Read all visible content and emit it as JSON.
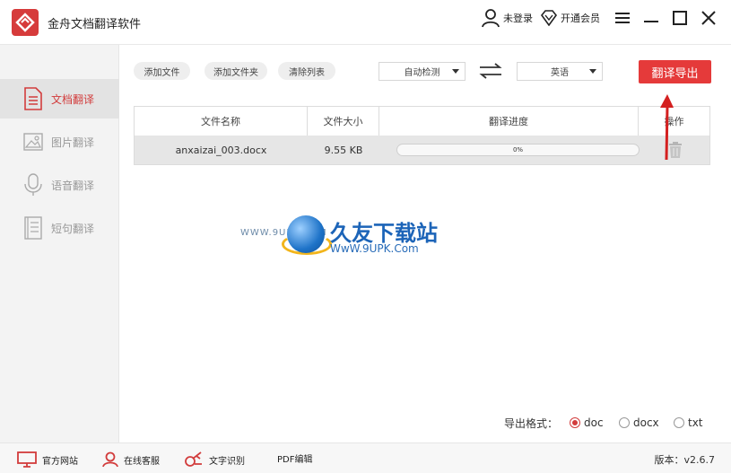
{
  "app": {
    "title": "金舟文档翻译软件"
  },
  "titlebar": {
    "login": "未登录",
    "vip": "开通会员"
  },
  "sidebar": {
    "items": [
      {
        "label": "文档翻译",
        "icon": "document-icon",
        "active": true
      },
      {
        "label": "图片翻译",
        "icon": "image-icon",
        "active": false
      },
      {
        "label": "语音翻译",
        "icon": "microphone-icon",
        "active": false
      },
      {
        "label": "短句翻译",
        "icon": "text-icon",
        "active": false
      }
    ]
  },
  "toolbar": {
    "add_file": "添加文件",
    "add_folder": "添加文件夹",
    "clear_list": "清除列表",
    "source_lang": "自动检测",
    "target_lang": "英语",
    "export": "翻译导出"
  },
  "table": {
    "headers": [
      "文件名称",
      "文件大小",
      "翻译进度",
      "操作"
    ],
    "rows": [
      {
        "name": "anxaizai_003.docx",
        "size": "9.55 KB",
        "progress_text": "0%",
        "progress": 0
      }
    ]
  },
  "watermark": {
    "url_small": "WWW.9UPK.COM",
    "title": "久友下载站",
    "url": "WwW.9UPK.Com"
  },
  "export_format": {
    "label": "导出格式：",
    "options": [
      {
        "label": "doc",
        "checked": true
      },
      {
        "label": "docx",
        "checked": false
      },
      {
        "label": "txt",
        "checked": false
      }
    ]
  },
  "footer": {
    "website": "官方网站",
    "support": "在线客服",
    "ocr": "文字识别",
    "pdf": "PDF编辑",
    "version": "版本：v2.6.7"
  },
  "colors": {
    "accent": "#e53a3a",
    "sidebar_bg": "#f3f3f3",
    "row_bg": "#e6e6e6"
  }
}
